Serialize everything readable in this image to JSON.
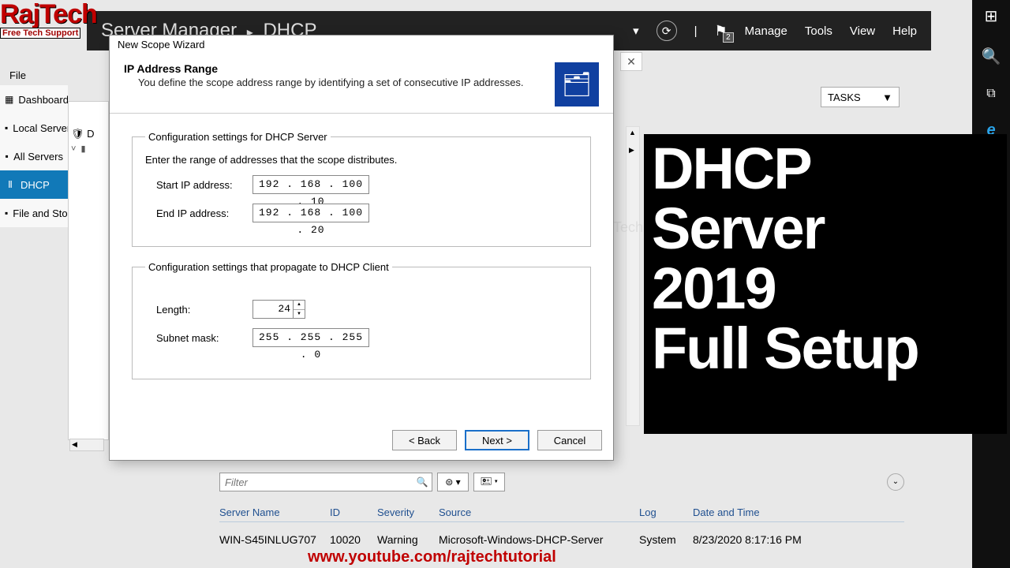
{
  "logo": {
    "top": "RajTech",
    "bot": "Free Tech Support"
  },
  "server_manager": {
    "breadcrumb_root": "Server Manager",
    "breadcrumb_leaf": "DHCP",
    "menu": {
      "manage": "Manage",
      "tools": "Tools",
      "view": "View",
      "help": "Help"
    },
    "flag_count": "2",
    "file_menu": "File"
  },
  "tasks_label": "TASKS",
  "nav": {
    "dashboard": "Dashboard",
    "local": "Local Server",
    "all": "All Servers",
    "dhcp": "DHCP",
    "file": "File and Storage"
  },
  "dhcp_tree": {
    "root": "D"
  },
  "wizard": {
    "title": "New Scope Wizard",
    "heading": "IP Address Range",
    "subheading": "You define the scope address range by identifying a set of consecutive IP addresses.",
    "group1": {
      "legend": "Configuration settings for DHCP Server",
      "desc": "Enter the range of addresses that the scope distributes.",
      "start_label": "Start IP address:",
      "start_value": "192 . 168 . 100 .  10",
      "end_label": "End IP address:",
      "end_value": "192 . 168 . 100 .  20"
    },
    "group2": {
      "legend": "Configuration settings that propagate to DHCP Client",
      "length_label": "Length:",
      "length_value": "24",
      "mask_label": "Subnet mask:",
      "mask_value": "255 . 255 . 255 .   0"
    },
    "buttons": {
      "back": "< Back",
      "next": "Next >",
      "cancel": "Cancel"
    }
  },
  "filter": {
    "placeholder": "Filter"
  },
  "grid": {
    "headers": {
      "server": "Server Name",
      "id": "ID",
      "severity": "Severity",
      "source": "Source",
      "log": "Log",
      "date": "Date and Time"
    },
    "row": {
      "server": "WIN-S45INLUG707",
      "id": "10020",
      "severity": "Warning",
      "source": "Microsoft-Windows-DHCP-Server",
      "log": "System",
      "date": "8/23/2020 8:17:16 PM"
    }
  },
  "overlay": {
    "l1": "DHCP",
    "l2": "Server",
    "l3": "2019",
    "l4": "Full Setup"
  },
  "yturl": "www.youtube.com/rajtechtutorial",
  "watermark": "RajTech"
}
